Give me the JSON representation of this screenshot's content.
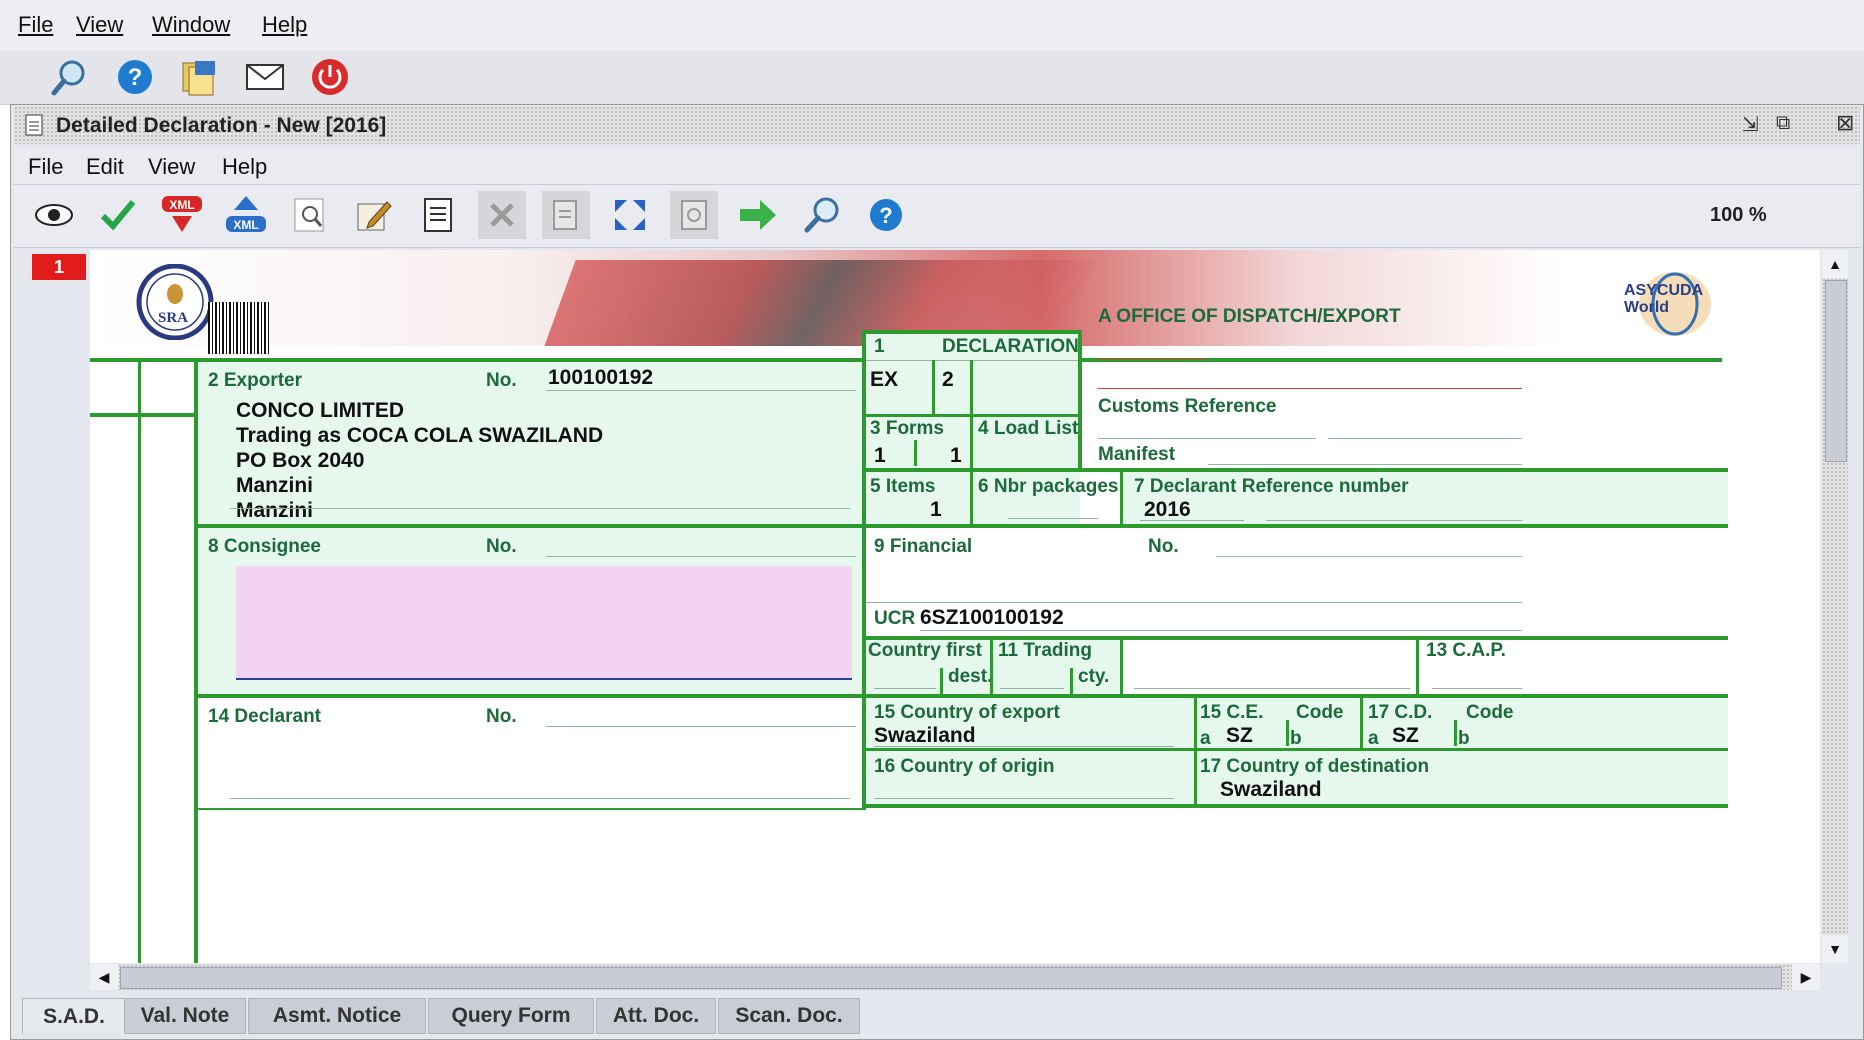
{
  "app_menu": [
    "File",
    "View",
    "Window",
    "Help"
  ],
  "app_toolbar_icons": [
    "magnifier-icon",
    "help-icon",
    "documents-icon",
    "mail-icon",
    "power-icon"
  ],
  "frame": {
    "title": "Detailed Declaration - New [2016]",
    "menu": [
      "File",
      "Edit",
      "View",
      "Help"
    ],
    "toolbar_icons": [
      "eye-icon",
      "check-icon",
      "xml-export-icon",
      "xml-import-icon",
      "preview-icon",
      "edit-icon",
      "document-icon",
      "delete-icon",
      "copy-icon",
      "expand-icon",
      "print-preview-icon",
      "arrow-right-icon",
      "find-icon",
      "help-icon"
    ],
    "zoom": "100 %",
    "page_badge": "1"
  },
  "banner": {
    "left_logo_text": "SRA",
    "right_logo_text": "ASYCUDA World"
  },
  "form": {
    "office_label": "A OFFICE OF DISPATCH/EXPORT",
    "decl_num": "1",
    "decl_label": "DECLARATION",
    "decl_type": "EX",
    "decl_sub": "2",
    "customs_ref_label": "Customs Reference",
    "manifest_label": "Manifest",
    "exporter_label": "2 Exporter",
    "no_label": "No.",
    "exporter_no": "100100192",
    "exporter_lines": [
      "CONCO LIMITED",
      "Trading as COCA COLA SWAZILAND",
      "PO Box 2040",
      "Manzini",
      "Manzini"
    ],
    "forms_label": "3 Forms",
    "forms_a": "1",
    "forms_b": "1",
    "load_list_label": "4 Load List",
    "items_label": "5 Items",
    "items_val": "1",
    "packages_label": "6 Nbr packages",
    "declarant_ref_label": "7  Declarant Reference number",
    "declarant_ref_val": "2016",
    "consignee_label": "8 Consignee",
    "financial_label": "9 Financial",
    "financial_no_label": "No.",
    "ucr_label": "UCR",
    "ucr_val": "6SZ100100192",
    "country_first_label": "Country first",
    "dest_label": "dest.",
    "trading_label": "11 Trading",
    "cty_label": "cty.",
    "cap_label": "13 C.A.P.",
    "declarant_label": "14 Declarant",
    "country_export_label": "15 Country of export",
    "country_export_val": "Swaziland",
    "ce_label": "15 C.E.",
    "code_label": "Code",
    "a_label": "a",
    "b_label": "b",
    "ce_a": "SZ",
    "cd_label": "17 C.D.",
    "cd_code_label": "Code",
    "cd_a": "SZ",
    "origin_label": "16 Country of origin",
    "destination_label": "17 Country of destination",
    "destination_val": "Swaziland"
  },
  "tabs": [
    "S.A.D.",
    "Val. Note",
    "Asmt. Notice",
    "Query Form",
    "Att. Doc.",
    "Scan. Doc."
  ],
  "colors": {
    "form_green": "#2c9a2c",
    "form_fill": "#e6f8ee",
    "consignee_fill": "#f3d3f2",
    "label": "#1d6a3a",
    "badge": "#e21b1b"
  }
}
